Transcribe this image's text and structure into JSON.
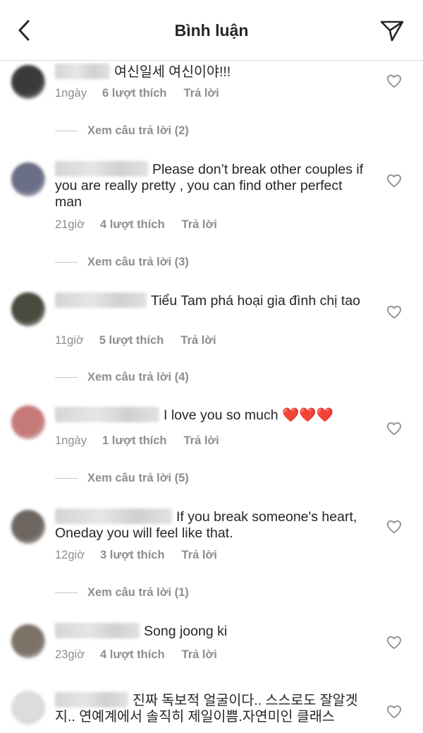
{
  "header": {
    "title": "Bình luận",
    "back_icon": "chevron-left-icon",
    "send_icon": "paper-plane-icon"
  },
  "view_replies_prefix": "Xem câu trả lời",
  "reply_label": "Trả lời",
  "comments": [
    {
      "text": "여신일세 여신이야!!!",
      "time": "1ngày",
      "likes": "6 lượt thích",
      "replies": "Xem câu trả lời (2)",
      "avatar_color": "#3a3a3a"
    },
    {
      "text": "Please don’t break other couples if you are really pretty , you can find other perfect man",
      "time": "21giờ",
      "likes": "4 lượt thích",
      "replies": "Xem câu trả lời (3)",
      "avatar_color": "#6a6e86"
    },
    {
      "text": "Tiểu Tam phá hoại gia đình chị tao",
      "time": "11giờ",
      "likes": "5 lượt thích",
      "replies": "Xem câu trả lời (4)",
      "avatar_color": "#4a4a3e"
    },
    {
      "text": "I love you so much ❤️❤️❤️",
      "time": "1ngày",
      "likes": "1 lượt thích",
      "replies": "Xem câu trả lời (5)",
      "avatar_color": "#c57a78"
    },
    {
      "text": "If you break someone's heart, Oneday you will feel like that.",
      "time": "12giờ",
      "likes": "3 lượt thích",
      "replies": "Xem câu trả lời (1)",
      "avatar_color": "#6e6660"
    },
    {
      "text": "Song joong ki",
      "time": "23giờ",
      "likes": "4 lượt thích",
      "replies": "",
      "avatar_color": "#7c7268"
    },
    {
      "text": "진짜 독보적 얼굴이다.. 스스로도 잘알겟지.. 연예계에서 솔직히 제일이쁨.자연미인 클래스",
      "time": "",
      "likes": "",
      "replies": "",
      "avatar_color": "#dcdcdc"
    }
  ]
}
